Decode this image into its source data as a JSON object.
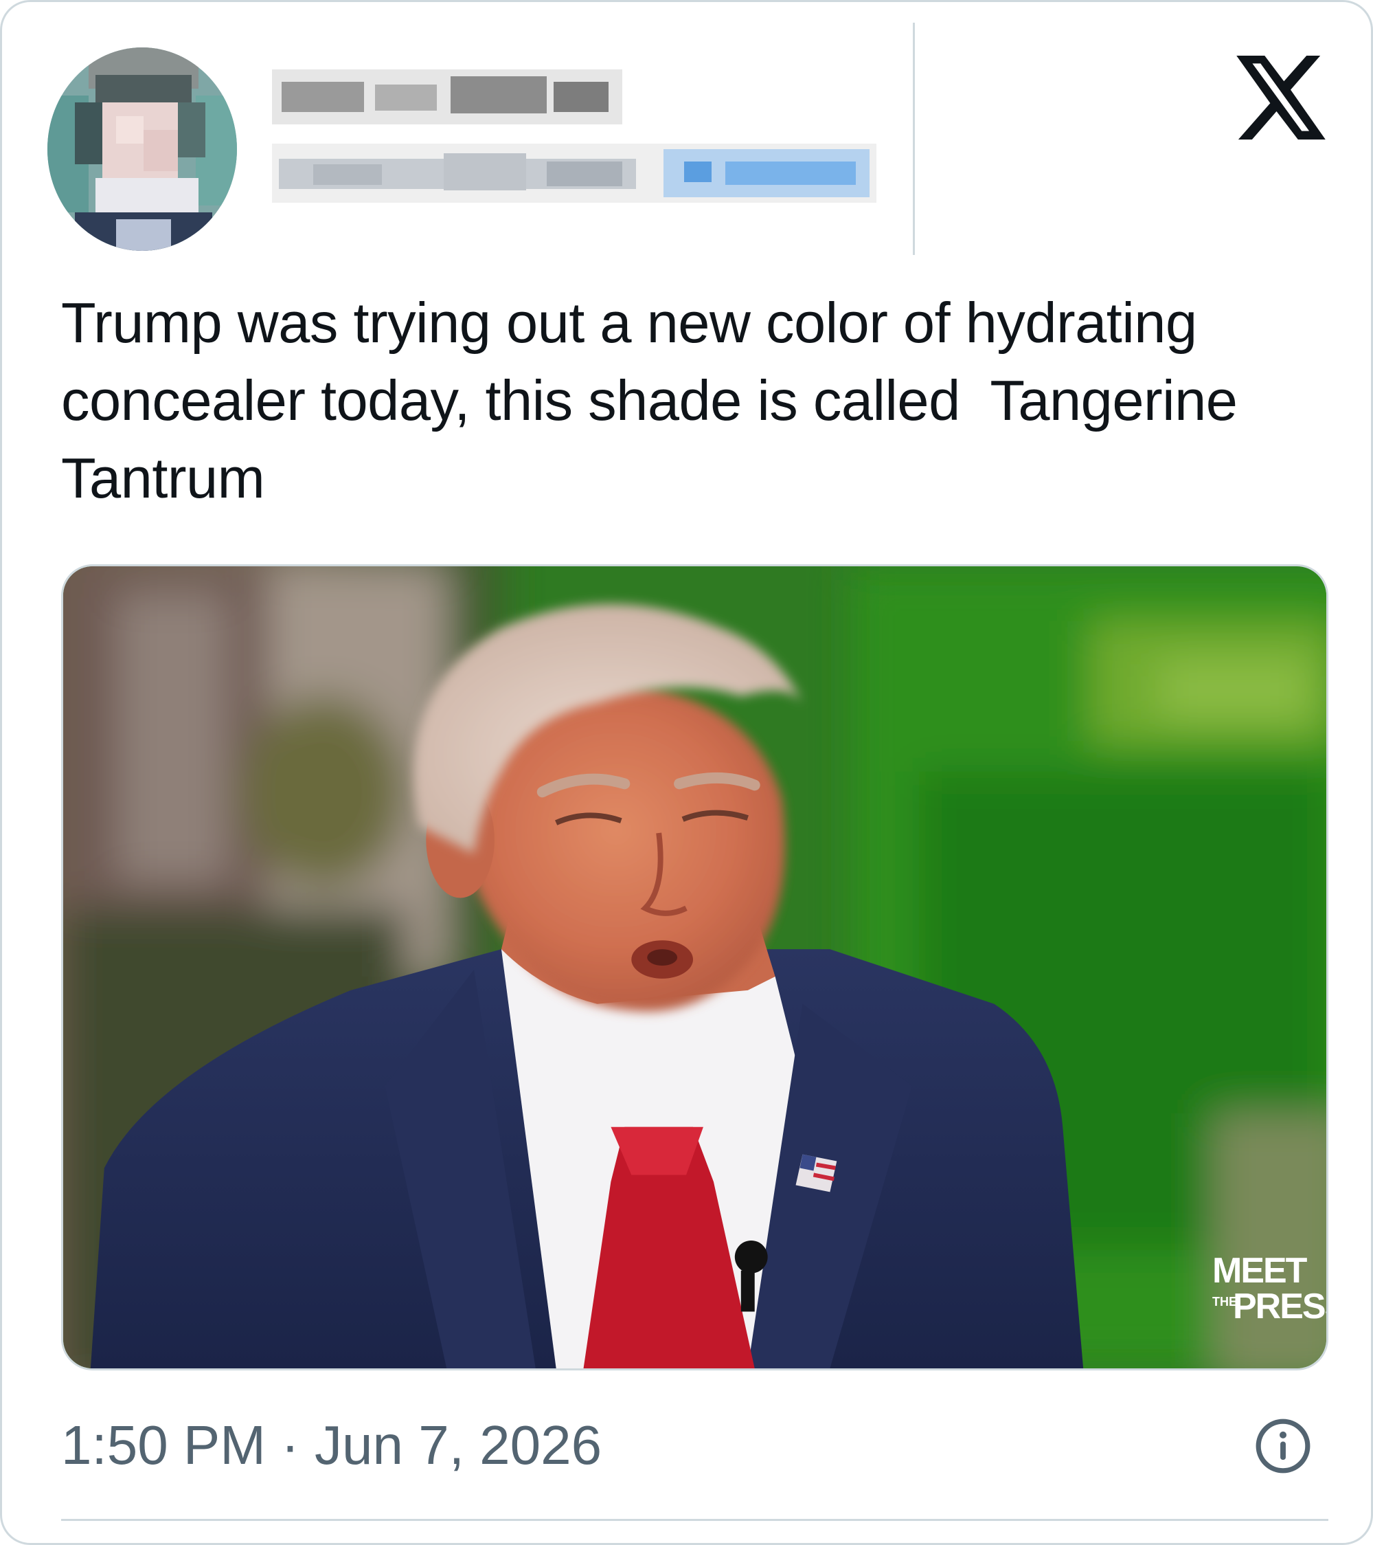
{
  "tweet": {
    "author": {
      "display_name": "",
      "handle": "",
      "follow_label": "",
      "avatar_style": "pixelated"
    },
    "text": "Trump was trying out a new color of hydrating concealer today, this shade is called  Tangerine Tantrum",
    "media": {
      "watermark_meet": "MEET",
      "watermark_the": "THE",
      "watermark_press": "PRESS"
    },
    "timestamp": "1:50 PM · Jun 7, 2026",
    "icons": {
      "platform": "x-logo-icon",
      "info": "info-icon"
    }
  },
  "colors": {
    "text_primary": "#0f1419",
    "text_secondary": "#536471",
    "border": "#cfd9de",
    "follow_link": "#1d9bf0"
  }
}
